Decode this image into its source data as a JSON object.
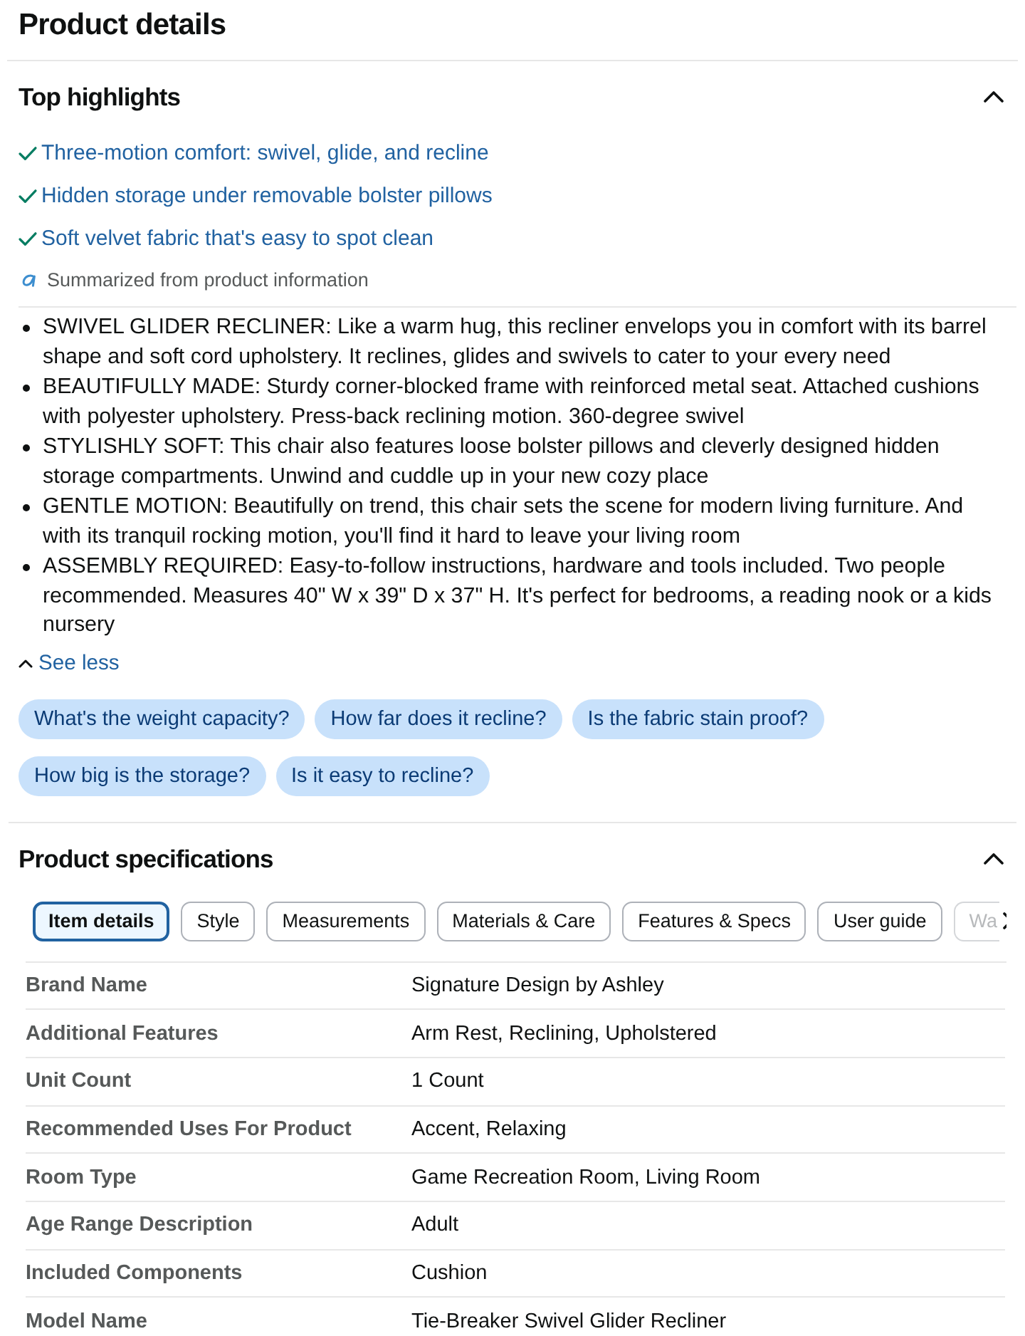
{
  "header": {
    "title": "Product details"
  },
  "top_highlights": {
    "title": "Top highlights",
    "expanded": true,
    "highlights": [
      "Three-motion comfort: swivel, glide, and recline",
      "Hidden storage under removable bolster pillows",
      "Soft velvet fabric that's easy to spot clean"
    ],
    "summary_note": "Summarized from product information",
    "bullets": [
      "SWIVEL GLIDER RECLINER: Like a warm hug, this recliner envelops you in comfort with its barrel shape and soft cord upholstery. It reclines, glides and swivels to cater to your every need",
      "BEAUTIFULLY MADE: Sturdy corner-blocked frame with reinforced metal seat. Attached cushions with polyester upholstery. Press-back reclining motion. 360-degree swivel",
      "STYLISHLY SOFT: This chair also features loose bolster pillows and cleverly designed hidden storage compartments. Unwind and cuddle up in your new cozy place",
      "GENTLE MOTION: Beautifully on trend, this chair sets the scene for modern living furniture. And with its tranquil rocking motion, you'll find it hard to leave your living room",
      "ASSEMBLY REQUIRED: Easy-to-follow instructions, hardware and tools included. Two people recommended. Measures 40\" W x 39\" D x 37\" H. It's perfect for bedrooms, a reading nook or a kids nursery"
    ],
    "toggle": {
      "label": "See less",
      "expanded": true
    },
    "questions": [
      "What's the weight capacity?",
      "How far does it recline?",
      "Is the fabric stain proof?",
      "How big is the storage?",
      "Is it easy to recline?"
    ]
  },
  "product_specifications": {
    "title": "Product specifications",
    "expanded": true,
    "tabs": [
      {
        "label": "Item details",
        "selected": true
      },
      {
        "label": "Style",
        "selected": false
      },
      {
        "label": "Measurements",
        "selected": false
      },
      {
        "label": "Materials & Care",
        "selected": false
      },
      {
        "label": "Features & Specs",
        "selected": false
      },
      {
        "label": "User guide",
        "selected": false
      },
      {
        "label": "Wa",
        "selected": false
      }
    ],
    "rows": [
      {
        "label": "Brand Name",
        "value": "Signature Design by Ashley"
      },
      {
        "label": "Additional Features",
        "value": "Arm Rest, Reclining, Upholstered"
      },
      {
        "label": "Unit Count",
        "value": "1 Count"
      },
      {
        "label": "Recommended Uses For Product",
        "value": "Accent, Relaxing"
      },
      {
        "label": "Room Type",
        "value": "Game Recreation Room, Living Room"
      },
      {
        "label": "Age Range Description",
        "value": "Adult"
      },
      {
        "label": "Included Components",
        "value": "Cushion"
      },
      {
        "label": "Model Name",
        "value": "Tie-Breaker Swivel Glider Recliner"
      }
    ]
  }
}
